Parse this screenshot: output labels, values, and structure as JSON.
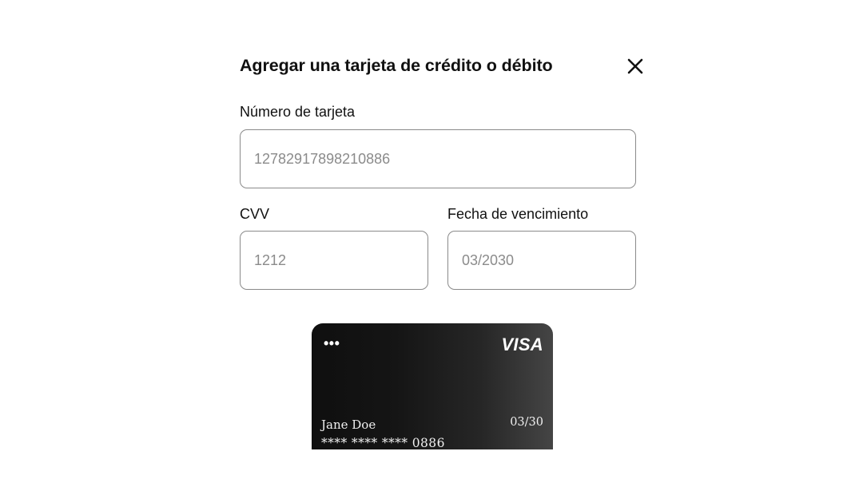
{
  "dialog": {
    "title": "Agregar una tarjeta de crédito o débito",
    "close_icon": "close-icon"
  },
  "form": {
    "card_number": {
      "label": "Número de tarjeta",
      "value": "12782917898210886"
    },
    "cvv": {
      "label": "CVV",
      "value": "1212"
    },
    "expiry": {
      "label": "Fecha de vencimiento",
      "value": "03/2030"
    }
  },
  "card_preview": {
    "menu_dots": "•••",
    "brand": "VISA",
    "holder_name": "Jane Doe",
    "expiry": "03/30",
    "masked_number": "**** **** **** 0886"
  },
  "colors": {
    "title_text": "#111111",
    "input_border": "#8a8a8a",
    "input_text": "#8b8b8b",
    "card_dark": "#0f0f0f",
    "card_light": "#454545"
  }
}
